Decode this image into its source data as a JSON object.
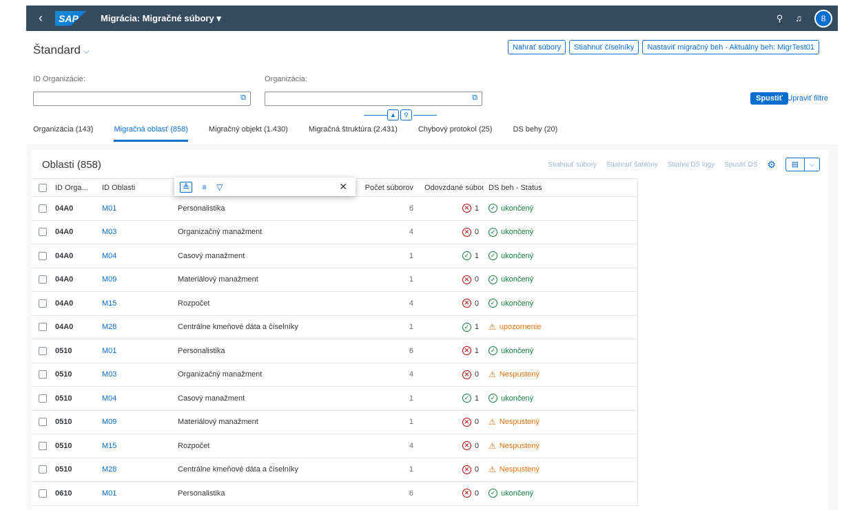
{
  "shell": {
    "back_icon": "‹",
    "logo": "SAP",
    "title": "Migrácia: Migračné súbory ▾",
    "search_icon": "⚲",
    "bell_icon": "♫",
    "avatar_icon": "8"
  },
  "header": {
    "variant": "Štandard",
    "buttons": [
      "Nahrať súbory",
      "Stiahnuť číselníky",
      "Nastaviť migračný beh - Aktuálny beh: MigrTest01"
    ],
    "share_icon": "⇗",
    "filters": [
      {
        "label": "ID Organizácie:",
        "value": ""
      },
      {
        "label": "Organizácia:",
        "value": ""
      }
    ],
    "go": "Spustiť",
    "adapt": "Upraviť filtre"
  },
  "tabs": [
    "Organizácia (143)",
    "Migračná oblasť (858)",
    "Migračný objekt (1.430)",
    "Migračná štruktúra (2.431)",
    "Chybový protokol (25)",
    "DS behy (20)"
  ],
  "table": {
    "title": "Oblasti (858)",
    "toolbar": [
      "Stiahnuť súbory",
      "Stiahnuť šablóny",
      "Stiahni DS logy",
      "Spustiť DS"
    ],
    "columns": [
      "ID Orga...",
      "ID Oblasti",
      "",
      "Počet súborov",
      "Odovzdané súbory",
      "DS beh - Status"
    ],
    "rows": [
      {
        "org": "04A0",
        "id": "M01",
        "name": "Personalistika",
        "count": "6",
        "up_state": "err",
        "up": "1",
        "ds_state": "ok",
        "ds": "ukončený"
      },
      {
        "org": "04A0",
        "id": "M03",
        "name": "Organizačný manažment",
        "count": "4",
        "up_state": "err",
        "up": "0",
        "ds_state": "ok",
        "ds": "ukončený"
      },
      {
        "org": "04A0",
        "id": "M04",
        "name": "Casový manažment",
        "count": "1",
        "up_state": "ok",
        "up": "1",
        "ds_state": "ok",
        "ds": "ukončený"
      },
      {
        "org": "04A0",
        "id": "M09",
        "name": "Materiálový manažment",
        "count": "1",
        "up_state": "err",
        "up": "0",
        "ds_state": "ok",
        "ds": "ukončený"
      },
      {
        "org": "04A0",
        "id": "M15",
        "name": "Rozpočet",
        "count": "4",
        "up_state": "err",
        "up": "0",
        "ds_state": "ok",
        "ds": "ukončený"
      },
      {
        "org": "04A0",
        "id": "M28",
        "name": "Centrálne kmeňové dáta a číselníky",
        "count": "1",
        "up_state": "ok",
        "up": "1",
        "ds_state": "warn",
        "ds": "upozornenie"
      },
      {
        "org": "0510",
        "id": "M01",
        "name": "Personalistika",
        "count": "6",
        "up_state": "err",
        "up": "1",
        "ds_state": "ok",
        "ds": "ukončený"
      },
      {
        "org": "0510",
        "id": "M03",
        "name": "Organizačný manažment",
        "count": "4",
        "up_state": "err",
        "up": "0",
        "ds_state": "warn",
        "ds": "Nespustený"
      },
      {
        "org": "0510",
        "id": "M04",
        "name": "Casový manažment",
        "count": "1",
        "up_state": "ok",
        "up": "1",
        "ds_state": "ok",
        "ds": "ukončený"
      },
      {
        "org": "0510",
        "id": "M09",
        "name": "Materiálový manažment",
        "count": "1",
        "up_state": "err",
        "up": "0",
        "ds_state": "warn",
        "ds": "Nespustený"
      },
      {
        "org": "0510",
        "id": "M15",
        "name": "Rozpočet",
        "count": "4",
        "up_state": "err",
        "up": "0",
        "ds_state": "warn",
        "ds": "Nespustený"
      },
      {
        "org": "0510",
        "id": "M28",
        "name": "Centrálne kmeňové dáta a číselníky",
        "count": "1",
        "up_state": "err",
        "up": "0",
        "ds_state": "warn",
        "ds": "Nespustený"
      },
      {
        "org": "0610",
        "id": "M01",
        "name": "Personalistika",
        "count": "6",
        "up_state": "err",
        "up": "0",
        "ds_state": "ok",
        "ds": "ukončený"
      }
    ]
  },
  "colors": {
    "shell": "#354a5f",
    "accent": "#0a6ed1",
    "error": "#bb0000",
    "success": "#107e3e",
    "warning": "#e9730c"
  }
}
